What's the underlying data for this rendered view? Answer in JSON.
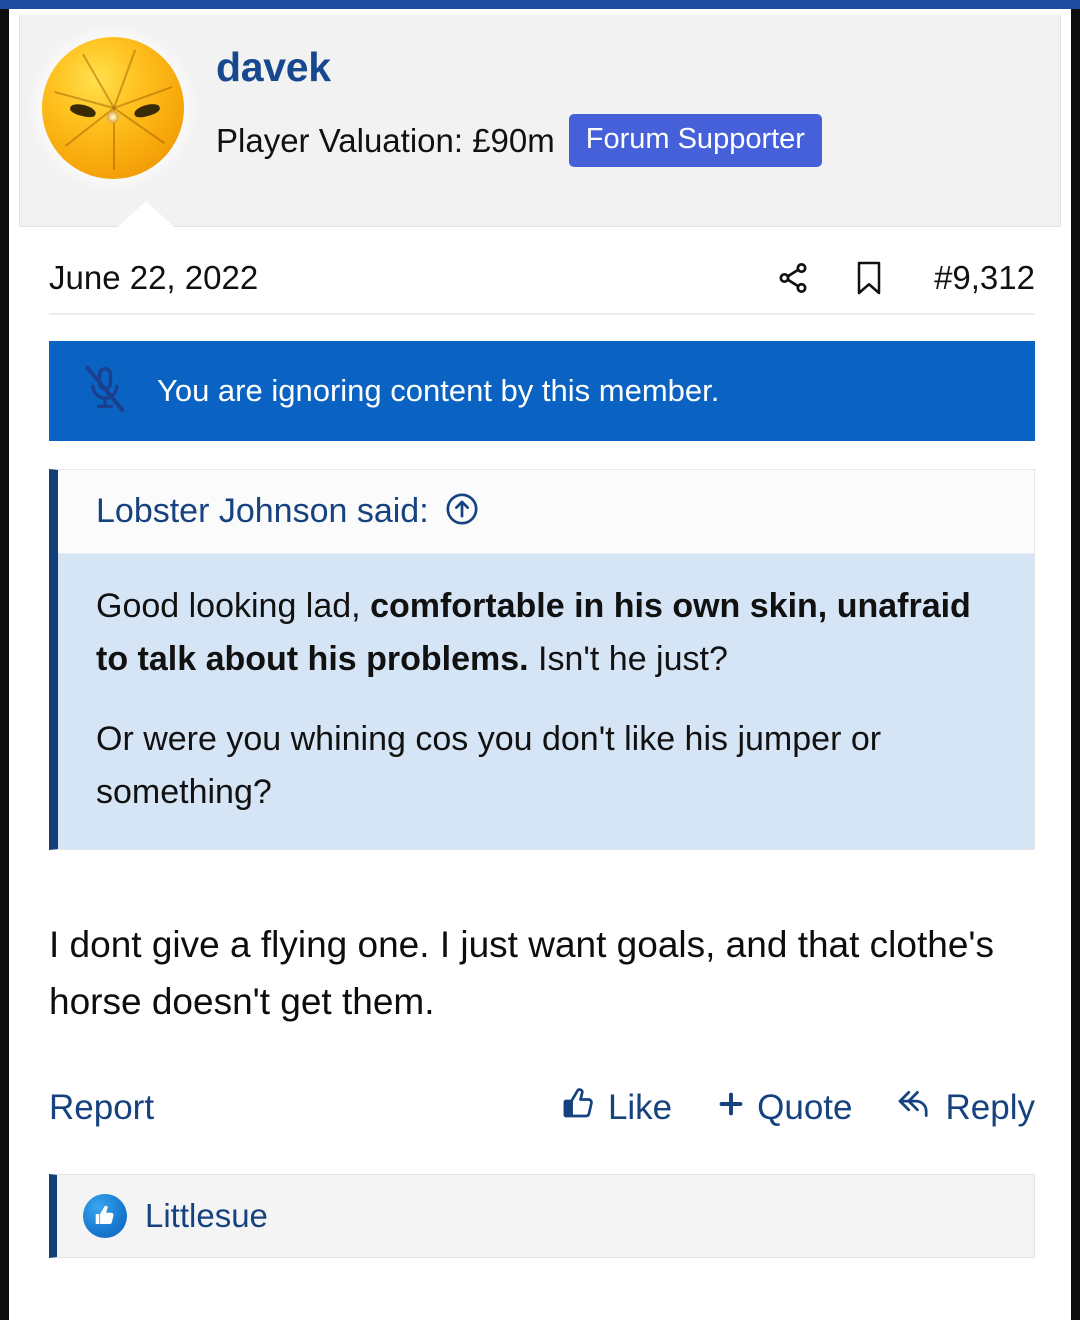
{
  "colors": {
    "topbar": "#1d4ba0",
    "username": "#17478f",
    "badge_bg": "#4560d8",
    "ignore_banner_bg": "#0a63c2",
    "quote_border": "#123f79",
    "quote_body_bg": "#d6e5f5",
    "link": "#16437f"
  },
  "header": {
    "avatar_alt": "orange-fruit-face-avatar",
    "username": "davek",
    "valuation": "Player Valuation: £90m",
    "badge": "Forum Supporter"
  },
  "post_meta": {
    "date": "June 22, 2022",
    "share_icon": "share-icon",
    "bookmark_icon": "bookmark-icon",
    "post_number": "#9,312"
  },
  "ignore_notice": {
    "icon": "microphone-muted-icon",
    "text": "You are ignoring content by this member."
  },
  "quote": {
    "author_line": "Lobster Johnson said:",
    "jump_icon": "arrow-up-circle-icon",
    "paragraphs": [
      {
        "parts": [
          {
            "text": "Good looking lad, ",
            "bold": false
          },
          {
            "text": "comfortable in his own skin, unafraid to talk about his problems.",
            "bold": true
          },
          {
            "text": " Isn't he just?",
            "bold": false
          }
        ]
      },
      {
        "parts": [
          {
            "text": "Or were you whining cos you don't like his jumper or something?",
            "bold": false
          }
        ]
      }
    ]
  },
  "post_body": {
    "text": "I dont give a flying one. I just want goals, and that clothe's horse doesn't get them."
  },
  "actions": {
    "report": "Report",
    "like": "Like",
    "like_icon": "thumbs-up-icon",
    "quote": "Quote",
    "quote_icon": "plus-icon",
    "reply": "Reply",
    "reply_icon": "reply-arrow-icon"
  },
  "reactions": {
    "icon": "thumbs-up-reaction-icon",
    "names": "Littlesue"
  }
}
